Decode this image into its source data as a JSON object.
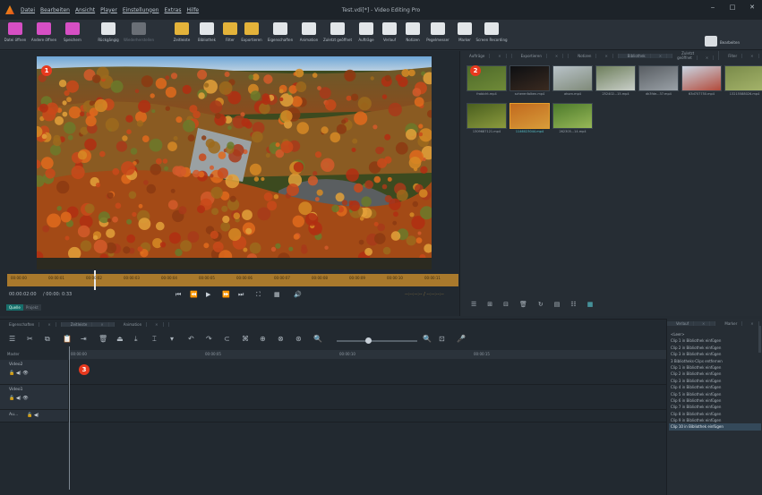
{
  "app": {
    "title": "Test.vdi[*] - Video Editing Pro"
  },
  "menu": [
    "Datei",
    "Bearbeiten",
    "Ansicht",
    "Player",
    "Einstellungen",
    "Extras",
    "Hilfe"
  ],
  "window_controls": [
    "‒",
    "□",
    "✕"
  ],
  "toolbar": [
    {
      "label": "Datei öffnen",
      "icon": "folder-icon",
      "color": "#d64fc4"
    },
    {
      "label": "Andere öffnen",
      "icon": "open-other-icon",
      "color": "#d64fc4"
    },
    {
      "label": "Speichern",
      "icon": "save-icon",
      "color": "#d64fc4"
    },
    {
      "label": "Rückgängig",
      "icon": "undo-icon",
      "color": "#e2e6e9"
    },
    {
      "label": "Wiederherstellen",
      "icon": "redo-icon",
      "color": "#e2e6e9",
      "disabled": true
    },
    {
      "label": "Zeitleiste",
      "icon": "timeline-icon",
      "color": "#e4b33a"
    },
    {
      "label": "Bibliothek",
      "icon": "library-icon",
      "color": "#e2e6e9"
    },
    {
      "label": "Filter",
      "icon": "filter-icon",
      "color": "#e4b33a"
    },
    {
      "label": "Exportieren",
      "icon": "export-icon",
      "color": "#e4b33a"
    },
    {
      "label": "Eigenschaften",
      "icon": "properties-icon",
      "color": "#e2e6e9"
    },
    {
      "label": "Animation",
      "icon": "animation-icon",
      "color": "#e2e6e9"
    },
    {
      "label": "Zuletzt geöffnet",
      "icon": "recent-icon",
      "color": "#e2e6e9"
    },
    {
      "label": "Aufträge",
      "icon": "jobs-icon",
      "color": "#e2e6e9"
    },
    {
      "label": "Verlauf",
      "icon": "history-icon",
      "color": "#e2e6e9"
    },
    {
      "label": "Notizen",
      "icon": "notes-icon",
      "color": "#e2e6e9"
    },
    {
      "label": "Pegelmesser",
      "icon": "level-meter-icon",
      "color": "#e2e6e9"
    },
    {
      "label": "Marker",
      "icon": "marker-icon",
      "color": "#e2e6e9"
    },
    {
      "label": "Screen Recording",
      "icon": "screen-recording-icon",
      "color": "#e2e6e9"
    }
  ],
  "toolbar_right": {
    "label": "Bearbeiten",
    "icon": "layout-icon"
  },
  "player": {
    "badge": "1",
    "ruler_ticks": [
      "00:00:00",
      "00:00:01",
      "00:00:02",
      "00:00:03",
      "00:00:04",
      "00:00:05",
      "00:00:06",
      "00:00:07",
      "00:00:08",
      "00:00:09",
      "00:00:10",
      "00:00:11"
    ],
    "timecode": "00:00:02:00",
    "duration": "/ 00:00: 0:33",
    "timecode_right": "--:--:--:-- / --:--:--:--",
    "view_tabs": [
      "Quelle",
      "Projekt"
    ]
  },
  "library": {
    "tabs": [
      "Aufträge",
      "Exportieren",
      "Notizen",
      "Bibliothek",
      "Zuletzt geöffnet",
      "Filter"
    ],
    "active_tab": "Bibliothek",
    "badge": "2",
    "items": [
      {
        "name": "frabicht.mp4",
        "c1": "#4e6a2a",
        "c2": "#6f8a38"
      },
      {
        "name": "scherenfalken.mp4",
        "c1": "#0d0f12",
        "c2": "#3a2a20"
      },
      {
        "name": "ahorn.mp4",
        "c1": "#b9c3c9",
        "c2": "#7f8a79"
      },
      {
        "name": "252402...15.mp4",
        "c1": "#6e7f5c",
        "c2": "#c9cfc9"
      },
      {
        "name": "dk3fde...37.mp4",
        "c1": "#595e63",
        "c2": "#9aa1a7"
      },
      {
        "name": "63d707750.mp4",
        "c1": "#c9d5e2",
        "c2": "#b34a3a"
      },
      {
        "name": "13215588026.mp4",
        "c1": "#7a8b4a",
        "c2": "#a4b36a"
      },
      {
        "name": "1309687121.mp4",
        "c1": "#4a5f1f",
        "c2": "#8b9a3d"
      },
      {
        "name": "1146023044.mp4",
        "c1": "#c26a1e",
        "c2": "#d79b3a"
      },
      {
        "name": "262305...14.mp4",
        "c1": "#4d7a2c",
        "c2": "#97b857"
      }
    ],
    "selected": "1146023044.mp4"
  },
  "timeline": {
    "tabs": [
      "Eigenschaften",
      "Zeitleiste",
      "Animation"
    ],
    "active_tab": "Zeitleiste",
    "badge": "3",
    "master_label": "Master",
    "ruler": [
      "00:00:00",
      "00:00:05",
      "00:00:10",
      "00:00:15"
    ],
    "tracks": [
      {
        "name": "Video2",
        "icons": "🔓 ◀) 👁"
      },
      {
        "name": "Video1",
        "icons": "🔓 ◀) 👁"
      },
      {
        "name": "Au...",
        "icons": "🔓 ◀)"
      }
    ]
  },
  "history": {
    "tabs": [
      "Verlauf",
      "Marker"
    ],
    "items": [
      "<Leer>",
      "Clip 1 in Bibliothek einfügen",
      "Clip 2 in Bibliothek einfügen",
      "Clip 3 in Bibliothek einfügen",
      "3 Bibliotheks-Clips entfernen",
      "Clip 1 in Bibliothek einfügen",
      "Clip 2 in Bibliothek einfügen",
      "Clip 3 in Bibliothek einfügen",
      "Clip 4 in Bibliothek einfügen",
      "Clip 5 in Bibliothek einfügen",
      "Clip 6 in Bibliothek einfügen",
      "Clip 7 in Bibliothek einfügen",
      "Clip 8 in Bibliothek einfügen",
      "Clip 9 in Bibliothek einfügen",
      "Clip 10 in Bibliothek einfügen"
    ],
    "selected_index": 14
  }
}
